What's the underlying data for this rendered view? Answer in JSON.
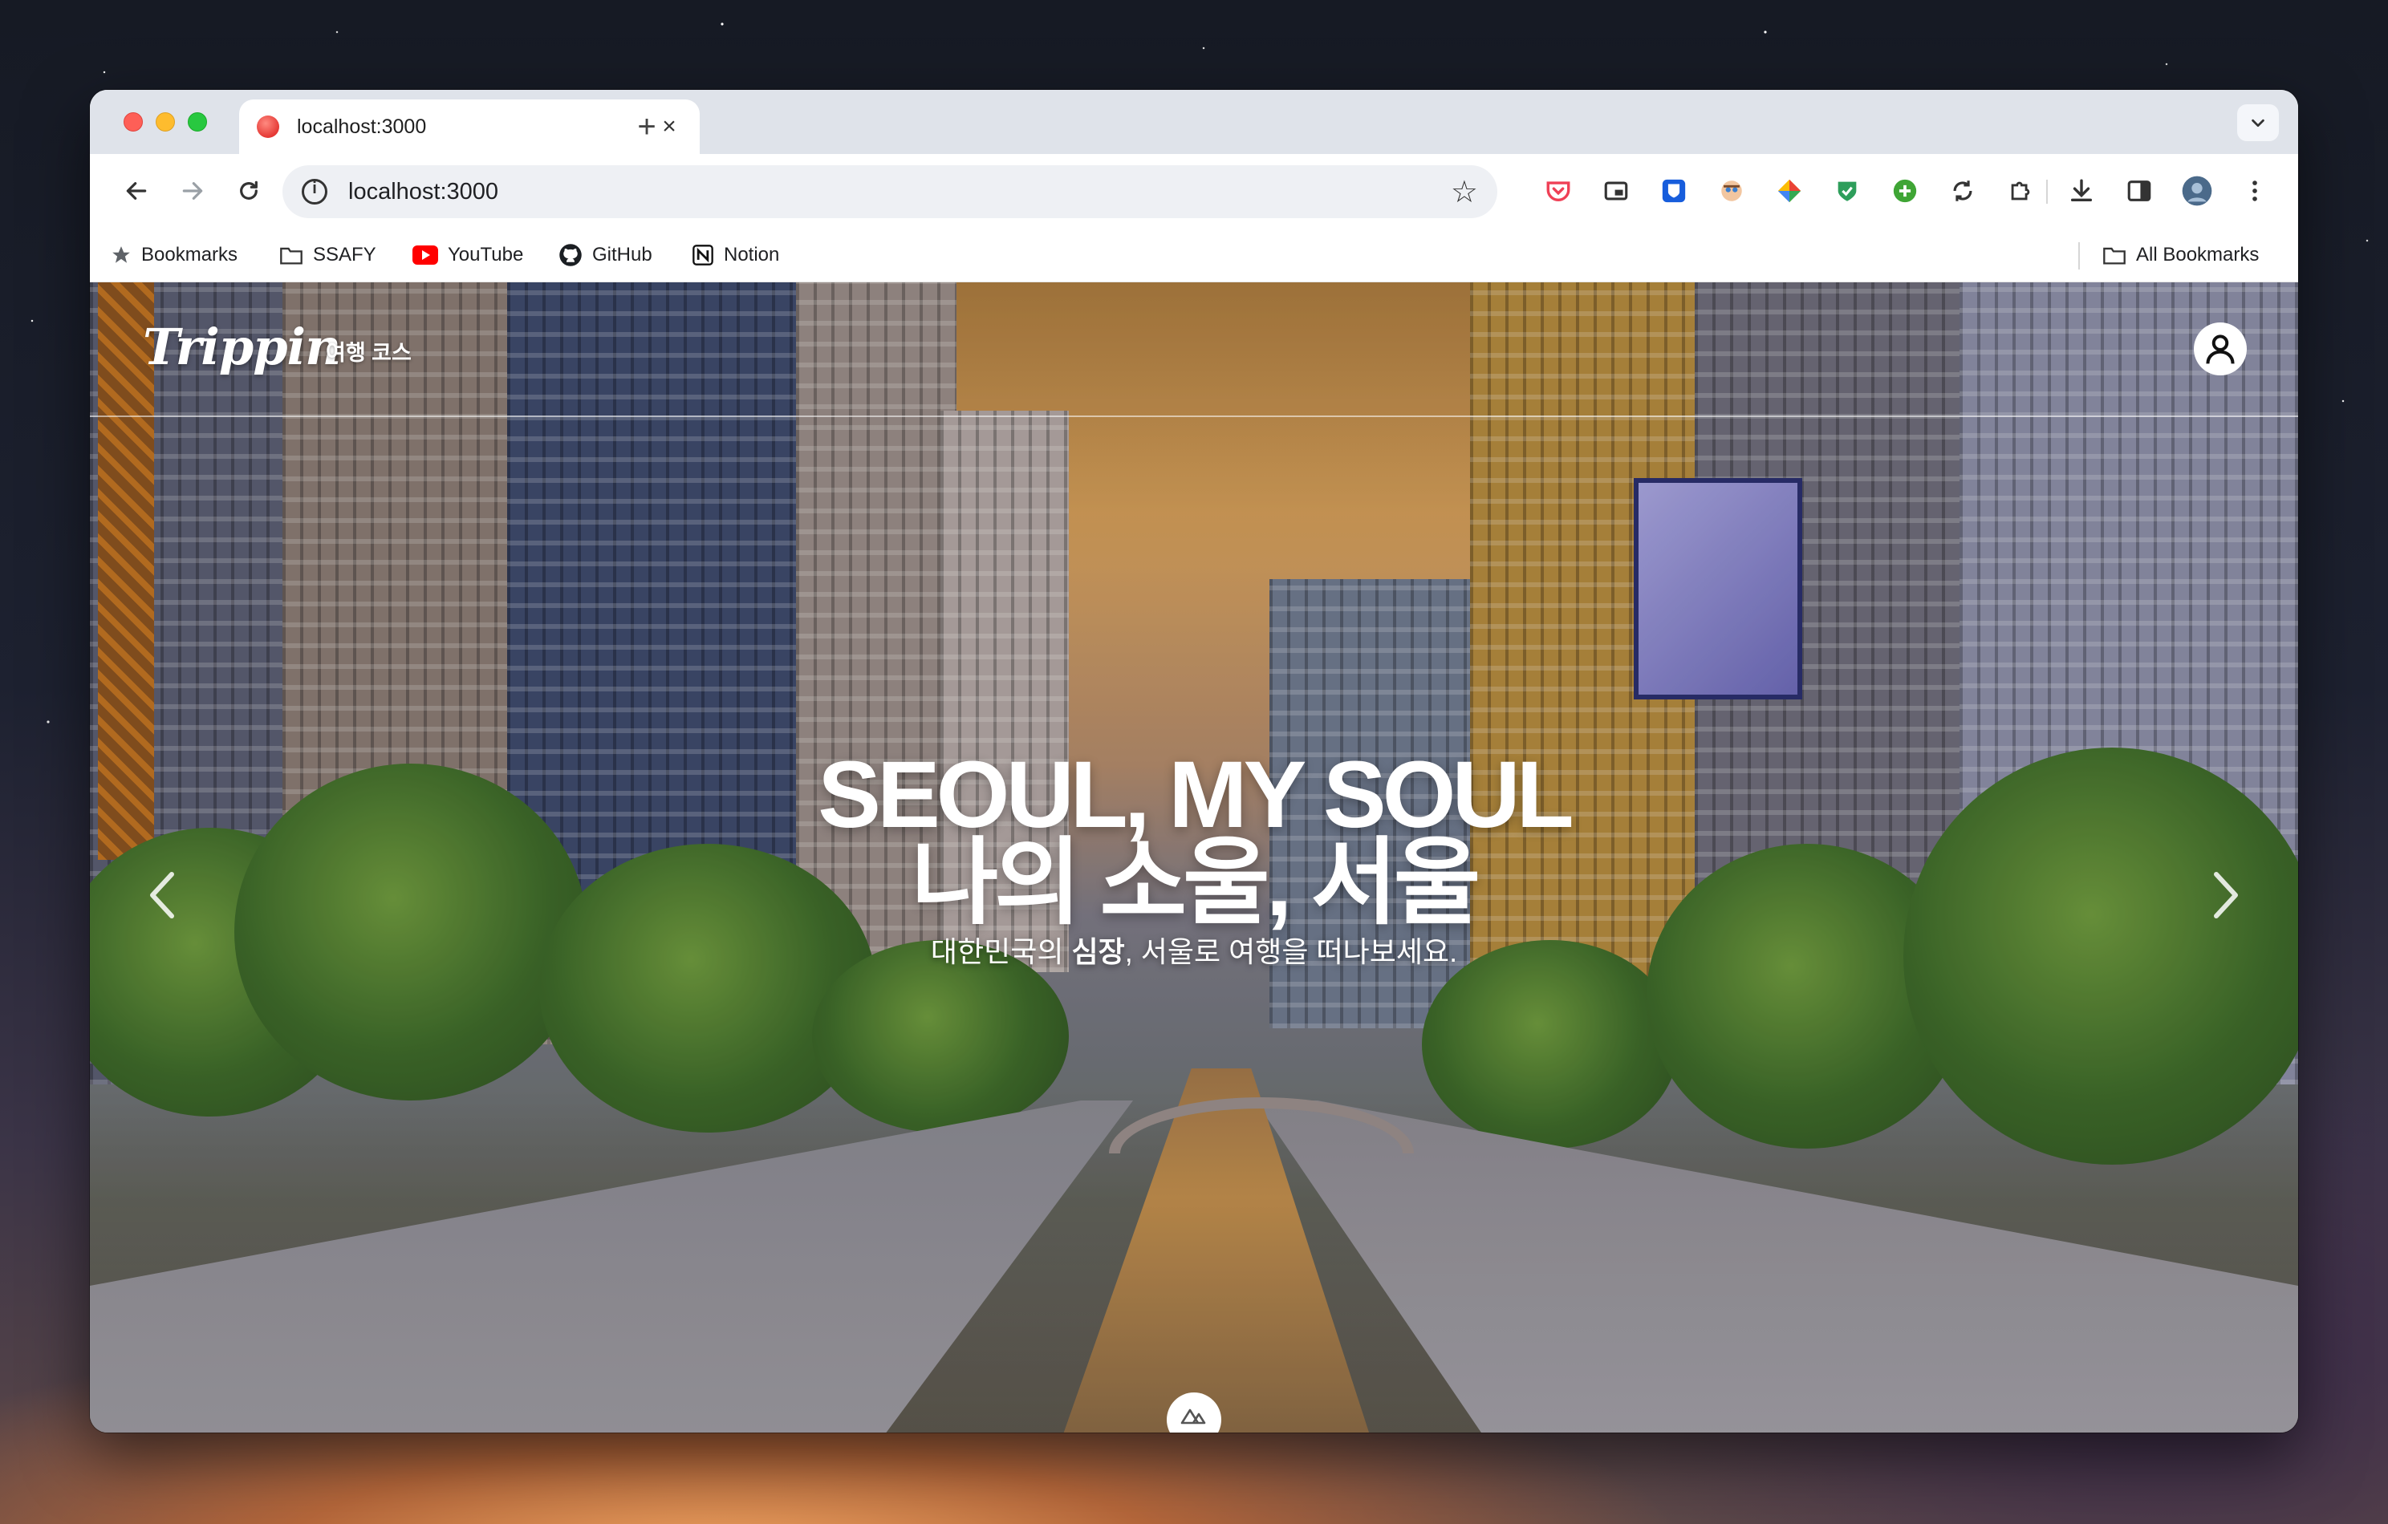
{
  "browser": {
    "tab_title": "localhost:3000",
    "tab_close": "×",
    "new_tab": "+",
    "url": "localhost:3000",
    "bookmarks": [
      {
        "label": "Bookmarks",
        "icon": "star-icon"
      },
      {
        "label": "SSAFY",
        "icon": "folder-icon"
      },
      {
        "label": "YouTube",
        "icon": "youtube-icon"
      },
      {
        "label": "GitHub",
        "icon": "github-icon"
      },
      {
        "label": "Notion",
        "icon": "notion-icon"
      }
    ],
    "all_bookmarks": "All Bookmarks",
    "extensions": [
      "pocket-icon",
      "picture-in-picture-icon",
      "bitwarden-icon",
      "avatar-extension-icon",
      "color-picker-icon",
      "shield-extension-icon",
      "add-circle-icon",
      "sync-icon",
      "puzzle-icon",
      "download-icon",
      "sidebar-icon",
      "profile-avatar-icon",
      "kebab-menu-icon"
    ]
  },
  "site": {
    "logo": "Trippin",
    "nav_link": "여행 코스",
    "hero": {
      "title_line1": "SEOUL, MY SOUL",
      "title_line2": "나의 소울, 서울",
      "subtitle_before": "대한민국의 ",
      "subtitle_bold": "심장",
      "subtitle_after": ", 서울로 여행을 떠나보세요."
    }
  },
  "colors": {
    "tabbar_bg": "#dfe3ea",
    "omnibox_bg": "#eef0f4",
    "hero_text": "#ffffff"
  }
}
